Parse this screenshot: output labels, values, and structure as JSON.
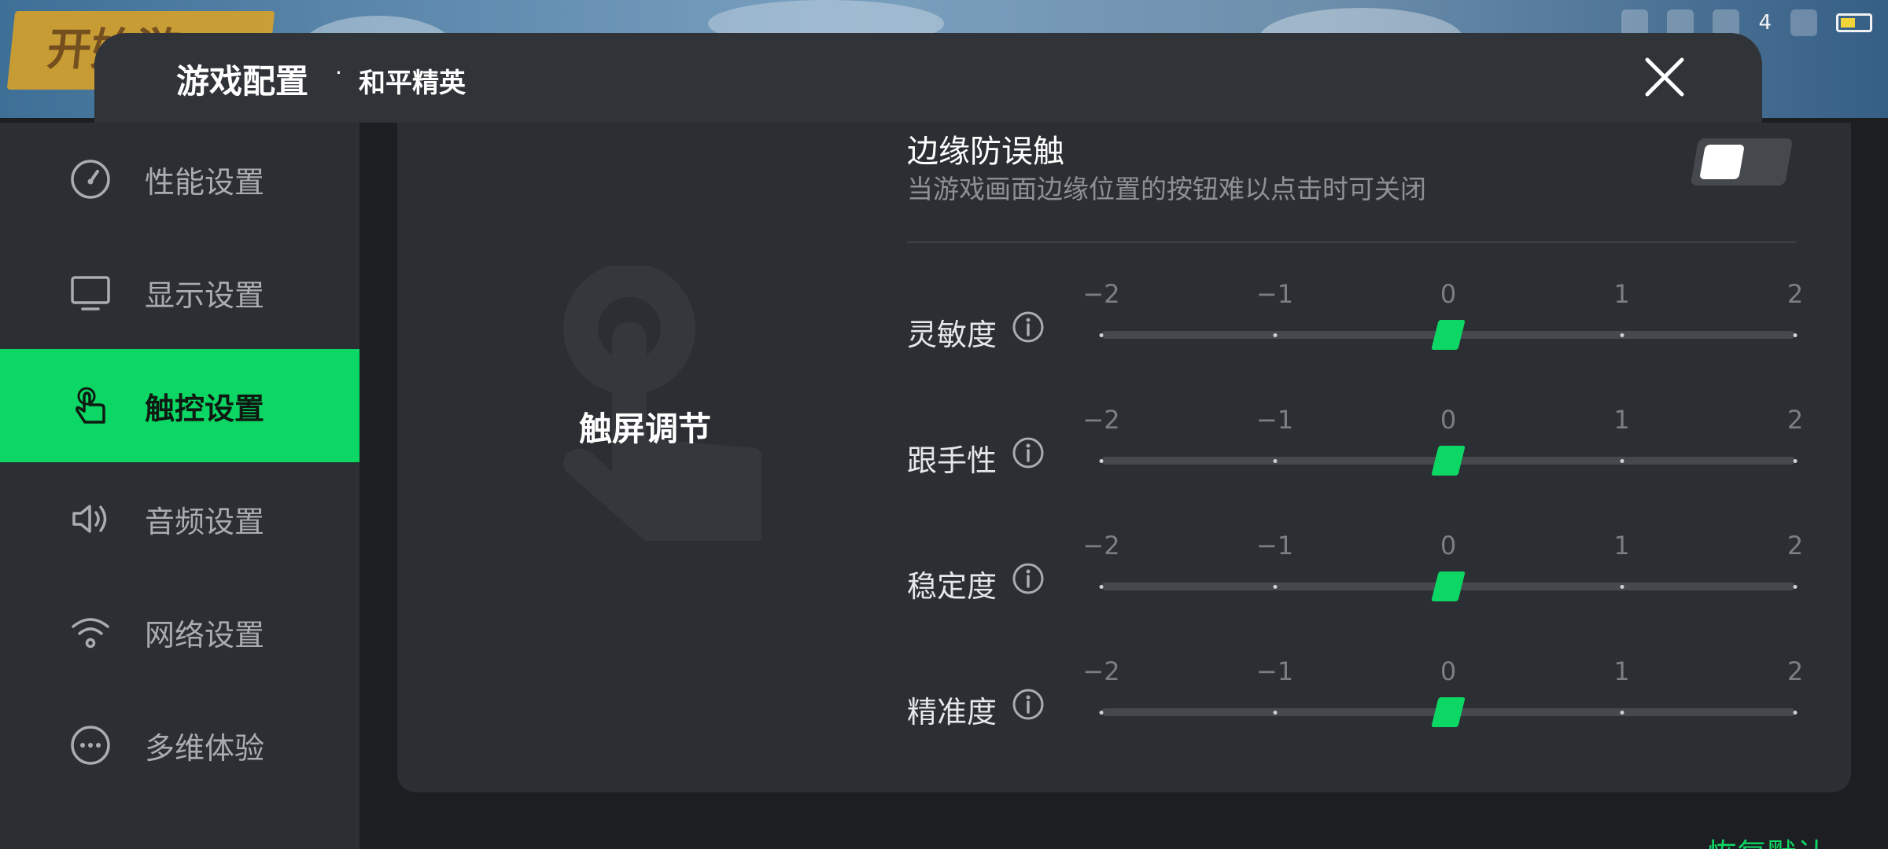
{
  "game_background": {
    "start_label": "开始游",
    "status_count": "4"
  },
  "header": {
    "title": "游戏配置",
    "separator": "·",
    "subtitle": "和平精英"
  },
  "sidebar": {
    "items": [
      {
        "label": "性能设置",
        "icon": "speedometer-icon",
        "active": false
      },
      {
        "label": "显示设置",
        "icon": "monitor-icon",
        "active": false
      },
      {
        "label": "触控设置",
        "icon": "touch-hand-icon",
        "active": true
      },
      {
        "label": "音频设置",
        "icon": "speaker-icon",
        "active": false
      },
      {
        "label": "网络设置",
        "icon": "wifi-icon",
        "active": false
      },
      {
        "label": "多维体验",
        "icon": "more-dots-icon",
        "active": false
      }
    ]
  },
  "main": {
    "section_title": "触屏调节",
    "edge_protection": {
      "title": "边缘防误触",
      "description": "当游戏画面边缘位置的按钮难以点击时可关闭",
      "enabled": false
    },
    "tick_labels": [
      "−2",
      "−1",
      "0",
      "1",
      "2"
    ],
    "sliders": [
      {
        "label": "灵敏度",
        "value": 0
      },
      {
        "label": "跟手性",
        "value": 0
      },
      {
        "label": "稳定度",
        "value": 0
      },
      {
        "label": "精准度",
        "value": 0
      }
    ],
    "restore_default": "恢复默认"
  },
  "colors": {
    "accent": "#0dd764",
    "panel": "#2b2e33",
    "header": "#303338",
    "background": "#1c1e21"
  }
}
